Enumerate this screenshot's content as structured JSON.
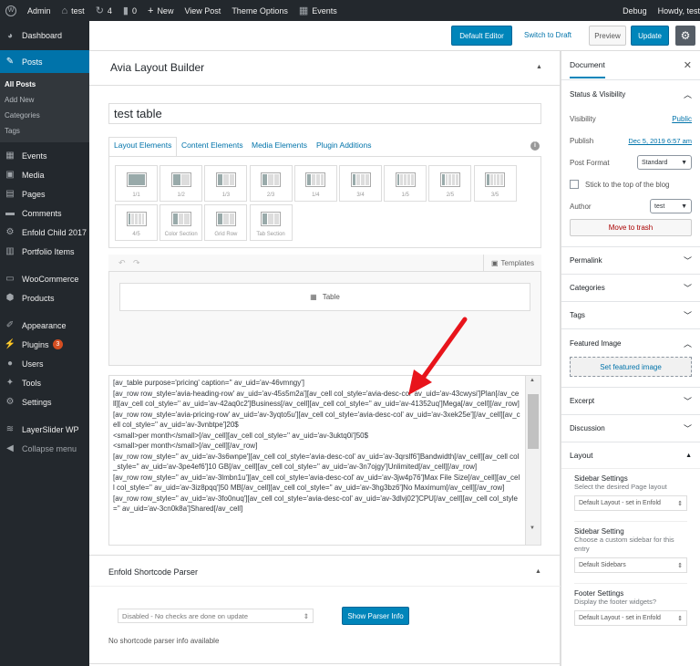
{
  "adminbar": {
    "items": [
      {
        "icon": "wp-logo-icon",
        "label": ""
      },
      {
        "icon": "home-icon",
        "label": "Admin"
      },
      {
        "icon": "house-icon",
        "label": "test"
      },
      {
        "icon": "updates-icon",
        "label": "4"
      },
      {
        "icon": "comments-icon",
        "label": "0"
      },
      {
        "icon": "plus-icon",
        "label": "New"
      },
      {
        "icon": "",
        "label": "View Post"
      },
      {
        "icon": "",
        "label": "Theme Options"
      },
      {
        "icon": "calendar-icon",
        "label": "Events"
      }
    ],
    "debug": "Debug",
    "howdy": "Howdy, test"
  },
  "sidebar": {
    "dashboard": "Dashboard",
    "posts": "Posts",
    "posts_sub": [
      "All Posts",
      "Add New",
      "Categories",
      "Tags"
    ],
    "items": [
      "Events",
      "Media",
      "Pages",
      "Comments",
      "Enfold Child 2017",
      "Portfolio Items"
    ],
    "items2": [
      "WooCommerce",
      "Products"
    ],
    "items3": [
      "Appearance",
      "Plugins",
      "Users",
      "Tools",
      "Settings"
    ],
    "plugins_badge": "3",
    "layerslider": "LayerSlider WP",
    "collapse": "Collapse menu"
  },
  "topbar": {
    "default_editor": "Default Editor",
    "switch_draft": "Switch to Draft",
    "preview": "Preview",
    "update": "Update"
  },
  "builder": {
    "title": "Avia Layout Builder",
    "post_title": "test table",
    "tabs": [
      "Layout Elements",
      "Content Elements",
      "Media Elements",
      "Plugin Additions"
    ],
    "elements": [
      "1/1",
      "1/2",
      "1/3",
      "2/3",
      "1/4",
      "3/4",
      "1/5",
      "2/5",
      "3/5",
      "4/5",
      "Color Section",
      "Grid Row",
      "Tab Section"
    ],
    "templates": "Templates",
    "canvas_element": "Table",
    "code": "[av_table purpose='pricing' caption='' av_uid='av-46vmngy']\n[av_row row_style='avia-heading-row' av_uid='av-45s5m2a'][av_cell col_style='avia-desc-col' av_uid='av-43cwysi']Plan[/av_cell][av_cell col_style='' av_uid='av-42aq0c2']Business[/av_cell][av_cell col_style='' av_uid='av-41352uq']Mega[/av_cell][/av_row]\n[av_row row_style='avia-pricing-row' av_uid='av-3yqto5u'][av_cell col_style='avia-desc-col' av_uid='av-3xek25e'][/av_cell][av_cell col_style='' av_uid='av-3vnbtpe']20$\n<small>per month</small>[/av_cell][av_cell col_style='' av_uid='av-3uktq0i']50$\n<small>per month</small>[/av_cell][/av_row]\n[av_row row_style='' av_uid='av-3s6wnpe'][av_cell col_style='avia-desc-col' av_uid='av-3qrslf6']Bandwidth[/av_cell][av_cell col_style='' av_uid='av-3pe4ef6']10 GB[/av_cell][av_cell col_style='' av_uid='av-3n7ojgy']Unlimited[/av_cell][/av_row]\n[av_row row_style='' av_uid='av-3lmbn1u'][av_cell col_style='avia-desc-col' av_uid='av-3jw4p76']Max File Size[/av_cell][av_cell col_style='' av_uid='av-3iz8pqq']50 MB[/av_cell][av_cell col_style='' av_uid='av-3hg3bz6']No Maximum[/av_cell][/av_row]\n[av_row row_style='' av_uid='av-3fo0nuq'][av_cell col_style='avia-desc-col' av_uid='av-3dlvj02']CPU[/av_cell][av_cell col_style='' av_uid='av-3cn0k8a']Shared[/av_cell]"
  },
  "parser": {
    "title": "Enfold Shortcode Parser",
    "select": "Disabled - No checks are done on update",
    "button": "Show Parser Info",
    "info": "No shortcode parser info available"
  },
  "panel": {
    "tab": "Document",
    "status_title": "Status & Visibility",
    "visibility_label": "Visibility",
    "visibility_value": "Public",
    "publish_label": "Publish",
    "publish_value": "Dec 5, 2019 6:57 am",
    "format_label": "Post Format",
    "format_value": "Standard",
    "sticky": "Stick to the top of the blog",
    "author_label": "Author",
    "author_value": "test",
    "trash": "Move to trash",
    "sections": [
      "Permalink",
      "Categories",
      "Tags"
    ],
    "featured": "Featured Image",
    "set_featured": "Set featured image",
    "sections2": [
      "Excerpt",
      "Discussion"
    ],
    "layout": "Layout",
    "sidebar_settings": {
      "title": "Sidebar Settings",
      "desc": "Select the desired Page layout",
      "value": "Default Layout - set in Enfold"
    },
    "sidebar_setting": {
      "title": "Sidebar Setting",
      "desc": "Choose a custom sidebar for this entry",
      "value": "Default Sidebars"
    },
    "footer_settings": {
      "title": "Footer Settings",
      "desc": "Display the footer widgets?",
      "value": "Default Layout - set in Enfold"
    }
  },
  "colors": {
    "accent": "#0085ba",
    "admin_dark": "#23282d",
    "arrow": "#e8141b"
  }
}
